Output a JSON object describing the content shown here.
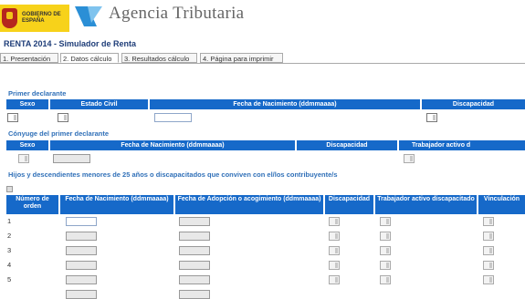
{
  "header": {
    "gov_logo_text": "GOBIERNO DE ESPAÑA",
    "brand": "Agencia Tributaria"
  },
  "app": {
    "title": "RENTA 2014 - Simulador de Renta"
  },
  "tabs": [
    {
      "label": "1. Presentación",
      "active": false
    },
    {
      "label": "2. Datos cálculo",
      "active": true
    },
    {
      "label": "3. Resultados cálculo",
      "active": false
    },
    {
      "label": "4. Página para imprimir",
      "active": false
    }
  ],
  "primer_declarante": {
    "title": "Primer declarante",
    "headers": [
      "Sexo",
      "Estado Civil",
      "Fecha de Nacimiento (ddmmaaaa)",
      "Discapacidad"
    ]
  },
  "conyuge": {
    "title": "Cónyuge del primer declarante",
    "headers": [
      "Sexo",
      "Fecha de Nacimiento (ddmmaaaa)",
      "Discapacidad",
      "Trabajador activo d"
    ]
  },
  "hijos": {
    "title": "Hijos y descendientes menores de 25 años o discapacitados que conviven con el/los contribuyente/s",
    "headers": [
      "Número de orden",
      "Fecha de Nacimiento (ddmmaaaa)",
      "Fecha de Adopción o acogimiento (ddmmaaaa)",
      "Discapacidad",
      "Trabajador activo discapacitado",
      "Vinculación"
    ],
    "rows": [
      "1",
      "2",
      "3",
      "4",
      "5"
    ]
  },
  "colors": {
    "header_blue": "#1669c9",
    "title_blue": "#1e3d78",
    "section_blue": "#3070b8"
  }
}
